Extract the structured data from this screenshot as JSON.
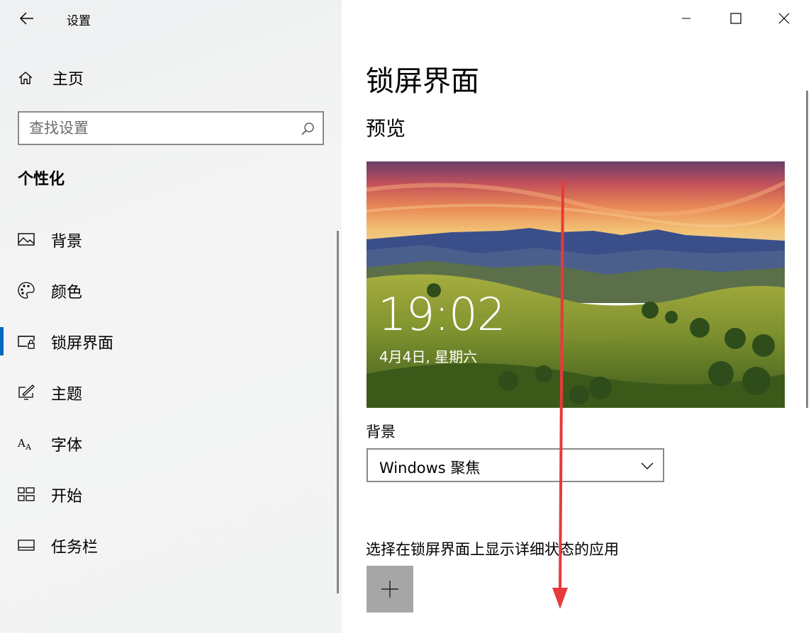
{
  "window": {
    "title": "设置"
  },
  "sidebar": {
    "home_label": "主页",
    "search_placeholder": "查找设置",
    "section_title": "个性化",
    "items": [
      {
        "label": "背景",
        "icon": "picture-icon"
      },
      {
        "label": "颜色",
        "icon": "palette-icon"
      },
      {
        "label": "锁屏界面",
        "icon": "lock-screen-icon",
        "active": true
      },
      {
        "label": "主题",
        "icon": "theme-brush-icon"
      },
      {
        "label": "字体",
        "icon": "font-icon"
      },
      {
        "label": "开始",
        "icon": "start-grid-icon"
      },
      {
        "label": "任务栏",
        "icon": "taskbar-icon"
      }
    ]
  },
  "main": {
    "page_title": "锁屏界面",
    "preview_heading": "预览",
    "preview": {
      "time": "19:02",
      "date": "4月4日, 星期六"
    },
    "background_label": "背景",
    "background_value": "Windows 聚焦",
    "apps_label": "选择在锁屏界面上显示详细状态的应用",
    "add_symbol": "+"
  },
  "colors": {
    "accent": "#0067c0",
    "annotation_arrow": "#e8393b",
    "add_button": "#a6a6a6"
  }
}
